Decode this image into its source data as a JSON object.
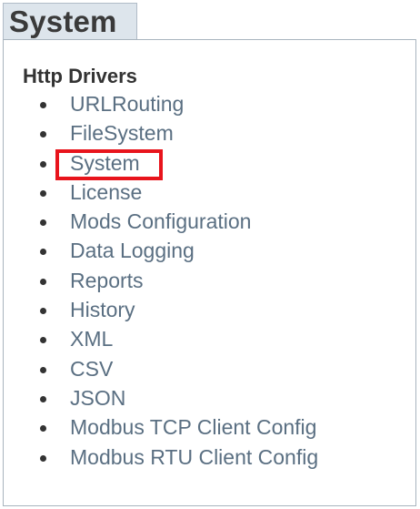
{
  "tab": {
    "title": "System"
  },
  "section": {
    "heading": "Http Drivers"
  },
  "drivers": [
    {
      "label": "URLRouting"
    },
    {
      "label": "FileSystem"
    },
    {
      "label": "System"
    },
    {
      "label": "License"
    },
    {
      "label": "Mods Configuration"
    },
    {
      "label": "Data Logging"
    },
    {
      "label": "Reports"
    },
    {
      "label": "History"
    },
    {
      "label": "XML"
    },
    {
      "label": "CSV"
    },
    {
      "label": "JSON"
    },
    {
      "label": "Modbus TCP Client Config"
    },
    {
      "label": "Modbus RTU Client Config"
    }
  ],
  "colors": {
    "link": "#5a6f82",
    "highlight": "#e8141c",
    "tab_background": "#dde5ec"
  }
}
